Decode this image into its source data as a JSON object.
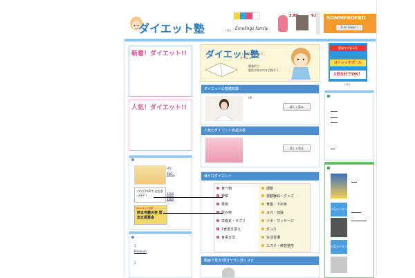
{
  "logo": {
    "text": "ダイエット塾"
  },
  "top_ad": {
    "brand": "Emelings family",
    "price1": "2.99",
    "price2": "9.99",
    "sale": "SOMMERDEKO",
    "shop_btn": "Zum Shop! ›",
    "label": "[PR]"
  },
  "left": {
    "new_title": "新着！ダイエット!!",
    "popular_title": "人気！ダイエット!!",
    "htc": "HTC",
    "htc_val": "500...",
    "blog_ad": "ブログやHPで 広告収入GET!!",
    "blog_ad_link1": "2500",
    "blog_ad_link2": "1000",
    "relief": "熊本地震災害 緊急支援募金",
    "relief_small": "Yahoo!ネット募金",
    "list_num1": "1",
    "list_item1": "Premium",
    "list_num2": "2"
  },
  "main": {
    "banner_title": "ダイエット塾",
    "banner_sub1": "正しい知識をもって",
    "banner_sub2": "ダイエット",
    "banner_sub3": "健康的で、",
    "banner_sub4": "脂肪が減るのを目指そう",
    "section1": "ダイエットの基礎知識",
    "section1_text": "UP",
    "detail1": "詳しく見る",
    "section2": "人気のダイエット食品比較",
    "detail2": "詳しく見る",
    "section3": "様々なダイエット",
    "menu_left": [
      "食べ物",
      "野菜",
      "果物",
      "飲み物",
      "栄養素・サプリ",
      "1食置き換え",
      "食事方法"
    ],
    "menu_right": [
      "運動",
      "運動器具・グッズ",
      "骨盤・下半身",
      "ヨガ・体操",
      "ツボ・マッサージ",
      "ダンス",
      "生活習慣",
      "エステ・美容整形"
    ],
    "section4": "動画で見る!部分ヤセに効くヨガ"
  },
  "right": {
    "ad1_line1": "登録で人気＆売",
    "ad1_line2": "ストレッチポール",
    "ad1_line3": "1日5分でOK！",
    "ad_label": "[PR]",
    "rank_label": "人気ランキング",
    "rank_label2": "人気ランキング"
  },
  "colors": {
    "accent_blue": "#4c8fd0",
    "pink": "#e65b9b",
    "light_blue": "#8cc6ef"
  }
}
